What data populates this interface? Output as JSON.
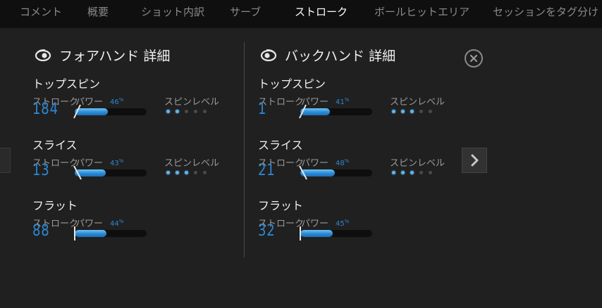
{
  "tabs": [
    {
      "label": "コメント",
      "active": false
    },
    {
      "label": "概要",
      "active": false
    },
    {
      "label": "ショット内訳",
      "active": false
    },
    {
      "label": "サーブ",
      "active": false
    },
    {
      "label": "ストローク",
      "active": true
    },
    {
      "label": "ボールヒットエリア",
      "active": false
    },
    {
      "label": "セッションをタグ分け",
      "active": false
    }
  ],
  "labels": {
    "stroke": "ストローク",
    "power": "パワー",
    "spin_level": "スピンレベル",
    "percent_sign": "%"
  },
  "forehand": {
    "title": "フォアハンド 詳細",
    "shots": [
      {
        "name": "トップスピン",
        "count": "184",
        "power": "46",
        "spin_level": 2
      },
      {
        "name": "スライス",
        "count": "13",
        "power": "43",
        "spin_level": 3
      },
      {
        "name": "フラット",
        "count": "88",
        "power": "44",
        "spin_level": null
      }
    ]
  },
  "backhand": {
    "title": "バックハンド 詳細",
    "shots": [
      {
        "name": "トップスピン",
        "count": "1",
        "power": "41",
        "spin_level": 3
      },
      {
        "name": "スライス",
        "count": "21",
        "power": "48",
        "spin_level": 3
      },
      {
        "name": "フラット",
        "count": "32",
        "power": "45",
        "spin_level": null
      }
    ]
  },
  "colors": {
    "accent": "#2d87d2",
    "bar": "#3a9be0",
    "background": "#202020",
    "tabbar": "#0f0f0f"
  },
  "icons": {
    "close": "close-circle-icon",
    "next": "chevron-right-icon",
    "forehand": "forehand-swing-icon",
    "backhand": "backhand-swing-icon"
  }
}
